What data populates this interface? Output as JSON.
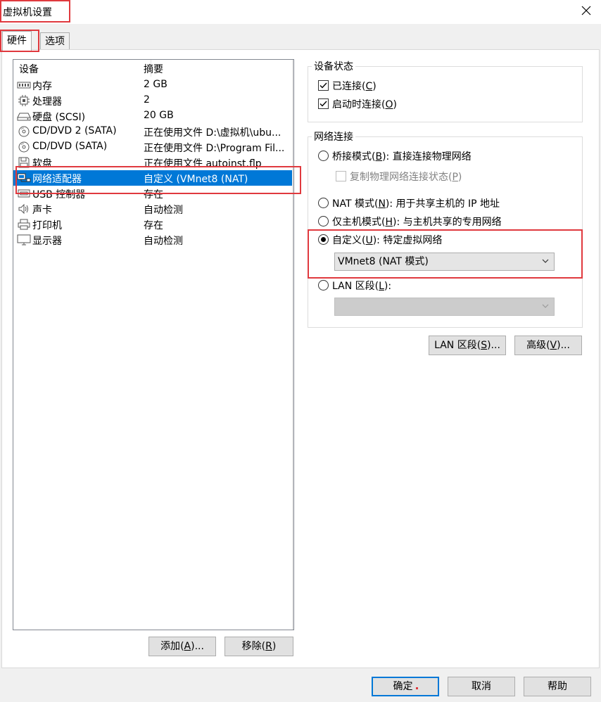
{
  "window": {
    "title": "虚拟机设置",
    "close_icon": "close-icon"
  },
  "tabs": [
    {
      "label": "硬件",
      "active": true
    },
    {
      "label": "选项",
      "active": false
    }
  ],
  "device_list": {
    "columns": [
      "设备",
      "摘要"
    ],
    "rows": [
      {
        "icon": "memory-icon",
        "device": "内存",
        "summary": "2 GB"
      },
      {
        "icon": "cpu-icon",
        "device": "处理器",
        "summary": "2"
      },
      {
        "icon": "hard-disk-icon",
        "device": "硬盘 (SCSI)",
        "summary": "20 GB"
      },
      {
        "icon": "cd-dvd-icon",
        "device": "CD/DVD 2 (SATA)",
        "summary": "正在使用文件 D:\\虚拟机\\ubu..."
      },
      {
        "icon": "cd-dvd-icon",
        "device": "CD/DVD (SATA)",
        "summary": "正在使用文件 D:\\Program Fil..."
      },
      {
        "icon": "floppy-icon",
        "device": "软盘",
        "summary": "正在使用文件 autoinst.flp"
      },
      {
        "icon": "network-adapter-icon",
        "device": "网络适配器",
        "summary": "自定义 (VMnet8 (NAT)",
        "selected": true
      },
      {
        "icon": "usb-icon",
        "device": "USB 控制器",
        "summary": "存在"
      },
      {
        "icon": "sound-icon",
        "device": "声卡",
        "summary": "自动检测"
      },
      {
        "icon": "printer-icon",
        "device": "打印机",
        "summary": "存在"
      },
      {
        "icon": "display-icon",
        "device": "显示器",
        "summary": "自动检测"
      }
    ]
  },
  "list_buttons": {
    "add": {
      "text": "添加",
      "key": "A",
      "suffix": ")..."
    },
    "remove": {
      "text": "移除",
      "key": "R",
      "suffix": ")"
    }
  },
  "device_status": {
    "title": "设备状态",
    "connected": {
      "text": "已连接",
      "key": "C",
      "suffix": ")",
      "checked": true
    },
    "connect_at_power_on": {
      "text": "启动时连接",
      "key": "O",
      "suffix": ")",
      "checked": true
    }
  },
  "network_connection": {
    "title": "网络连接",
    "bridged": {
      "text": "桥接模式",
      "key": "B",
      "suffix": "): 直接连接物理网络",
      "checked": false
    },
    "replicate": {
      "text": "复制物理网络连接状态",
      "key": "P",
      "suffix": ")",
      "checked": false,
      "disabled": true
    },
    "nat": {
      "text": "NAT 模式",
      "key": "N",
      "suffix": "): 用于共享主机的 IP 地址",
      "checked": false
    },
    "host_only": {
      "text": "仅主机模式",
      "key": "H",
      "suffix": "): 与主机共享的专用网络",
      "checked": false
    },
    "custom": {
      "text": "自定义",
      "key": "U",
      "suffix": "): 特定虚拟网络",
      "checked": true
    },
    "custom_select": {
      "value": "VMnet8 (NAT 模式)"
    },
    "lan": {
      "text": "LAN 区段",
      "key": "L",
      "suffix": "):",
      "checked": false
    },
    "lan_select": {
      "value": "",
      "disabled": true
    }
  },
  "network_buttons": {
    "lan_segments": {
      "text": "LAN 区段",
      "key": "S",
      "suffix": ")..."
    },
    "advanced": {
      "text": "高级",
      "key": "V",
      "suffix": ")..."
    }
  },
  "footer": {
    "ok": "确定",
    "cancel": "取消",
    "help": "帮助"
  },
  "colors": {
    "selection": "#0078d7",
    "highlight_annotation": "#e0393e",
    "primary_button_border": "#0078d7"
  }
}
